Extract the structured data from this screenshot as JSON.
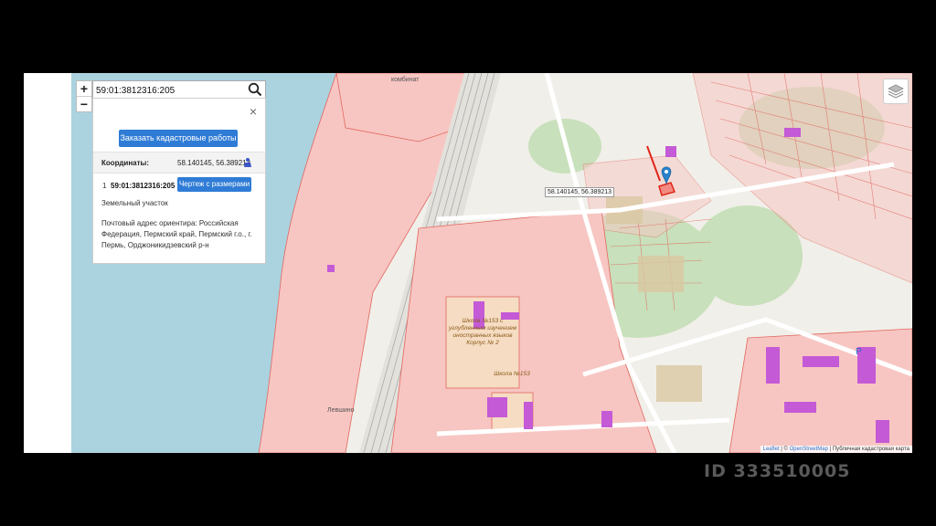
{
  "search": {
    "value": "59:01:3812316:205"
  },
  "zoom": {
    "in": "+",
    "out": "−"
  },
  "panel": {
    "close": "×",
    "order_button": "Заказать кадастровые работы",
    "coord_label": "Координаты:",
    "coord_value": "58.140145, 56.389213",
    "result_index": "1",
    "cad_number": "59:01:3812316:205",
    "drawing_button": "Чертеж с размерами",
    "object_type": "Земельный участок",
    "address": "Почтовый адрес ориентира: Российская Федерация, Пермский край, Пермский г.о., г. Пермь, Орджоникидзевский р-н"
  },
  "map": {
    "tooltip": "58.140145, 56.389213",
    "labels": {
      "top": "комбинат",
      "school_main": "Школа №153 с углубленным изучением иностранных языков Корпус № 2",
      "school_small": "Школа №153",
      "p": "P",
      "levshino": "Левшино"
    },
    "colors": {
      "water": "#aad3df",
      "cadastre": "#f7c6c2",
      "cad_line": "#e2665f",
      "green": "#c8e0bb",
      "building": "#c45ad6",
      "rail": "#bbbbbb"
    }
  },
  "attribution": {
    "leaflet": "Leaflet",
    "sep": " | © ",
    "osm": "OpenStreetMap",
    "pkk": " | Публичная кадастровая карта"
  },
  "watermark": "ID 333510005"
}
